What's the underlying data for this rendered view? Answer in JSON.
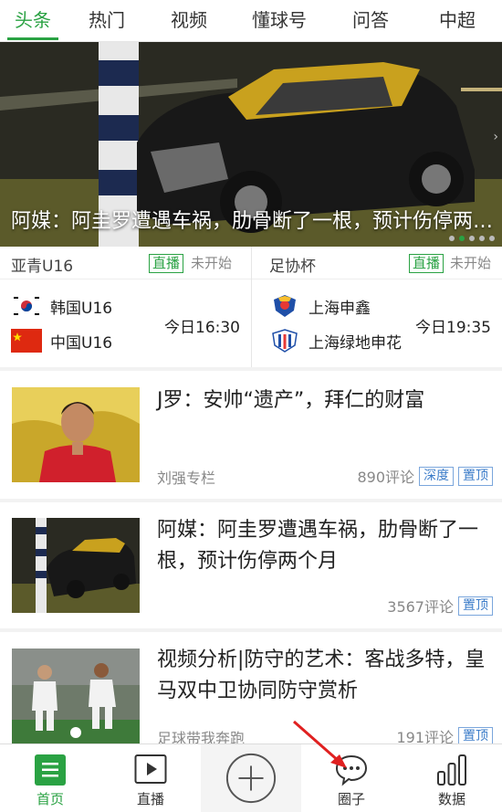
{
  "tabs": [
    "头条",
    "热门",
    "视频",
    "懂球号",
    "问答",
    "中超"
  ],
  "hero": {
    "caption": "阿媒：阿圭罗遭遇车祸，肋骨断了一根，预计伤停两个月"
  },
  "matches": [
    {
      "league": "亚青U16",
      "live_label": "直播",
      "status": "未开始",
      "home": "韩国U16",
      "away": "中国U16",
      "time": "今日16:30"
    },
    {
      "league": "足协杯",
      "live_label": "直播",
      "status": "未开始",
      "home": "上海申鑫",
      "away": "上海绿地申花",
      "time": "今日19:35"
    }
  ],
  "news": [
    {
      "title": "J罗：安帅“遗产”，拜仁的财富",
      "source": "刘强专栏",
      "comments": "890评论",
      "tags": [
        "深度",
        "置顶"
      ]
    },
    {
      "title": "阿媒：阿圭罗遭遇车祸，肋骨断了一根，预计伤停两个月",
      "source": "",
      "comments": "3567评论",
      "tags": [
        "置顶"
      ]
    },
    {
      "title": "视频分析|防守的艺术：客战多特，皇马双中卫协同防守赏析",
      "source": "足球带我奔跑",
      "comments": "191评论",
      "tags": [
        "置顶"
      ]
    }
  ],
  "bottom_nav": [
    "首页",
    "直播",
    "",
    "圈子",
    "数据"
  ],
  "colors": {
    "accent": "#2aa243",
    "tag_blue": "#3b7cc9"
  }
}
